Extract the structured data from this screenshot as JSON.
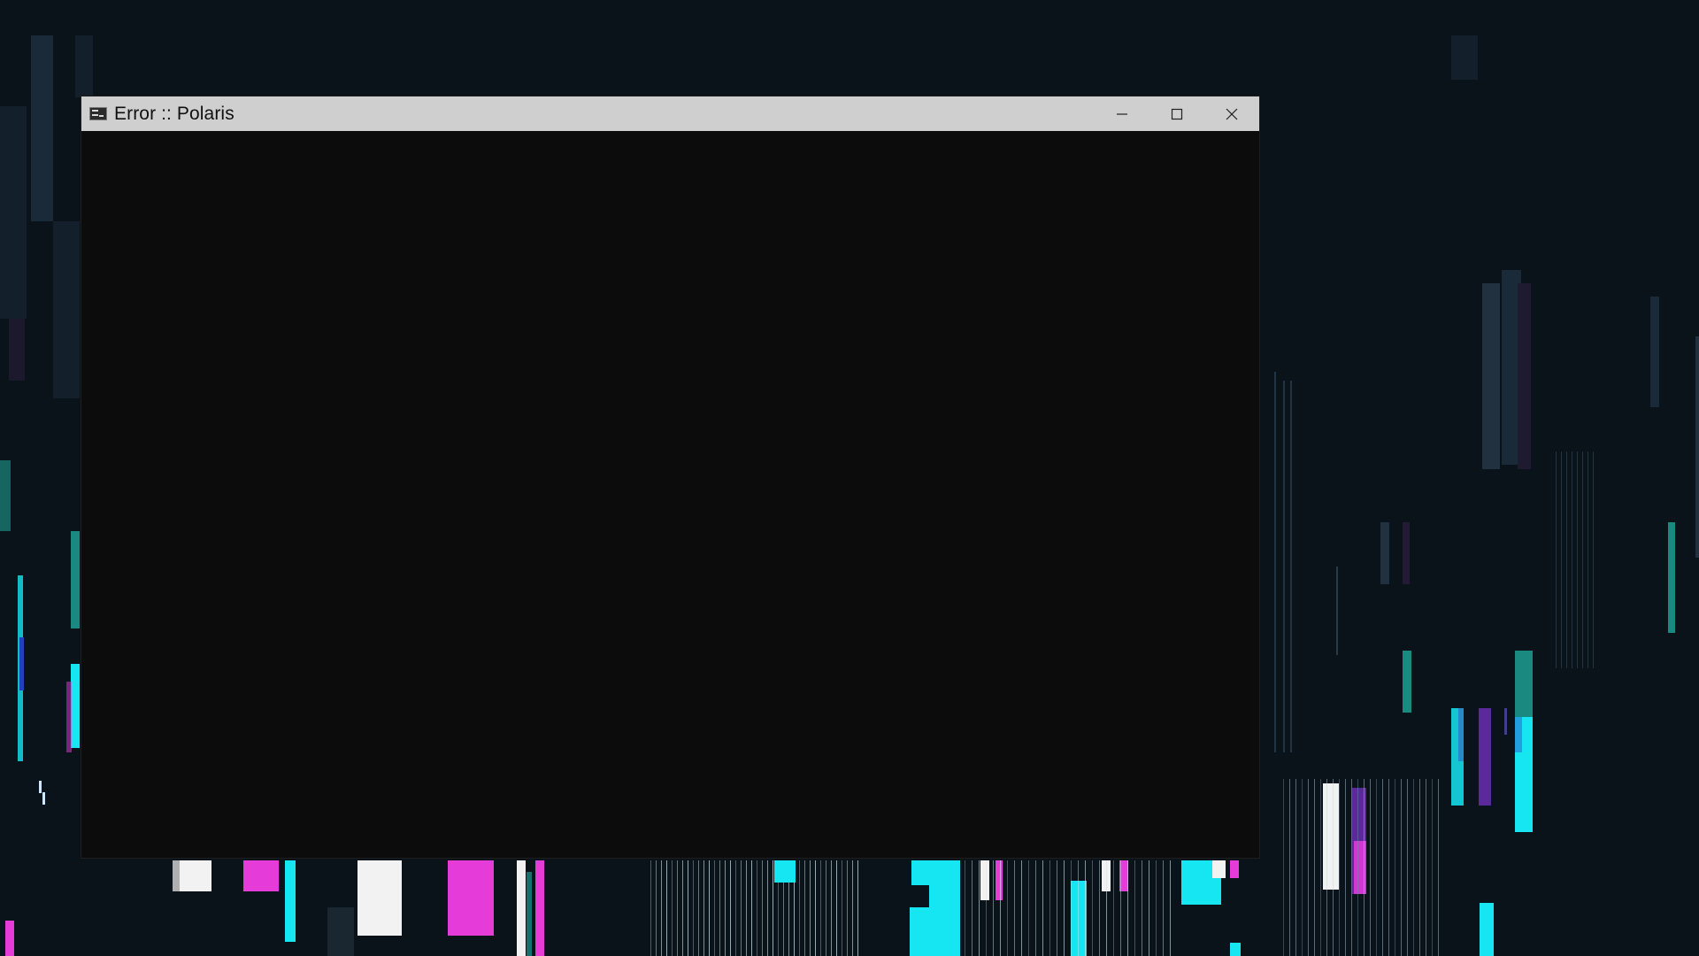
{
  "window": {
    "title": "Error :: Polaris",
    "icon": "console-icon",
    "controls": [
      "minimize-icon",
      "maximize-icon",
      "close-icon"
    ]
  },
  "colors": {
    "desktop_background": "#0a121a",
    "titlebar": "#cfcfcf",
    "console_background": "#0c0c0c",
    "glitch_cyan": "#16e6f2",
    "glitch_magenta": "#e53cd9",
    "glitch_white": "#f2f2f2",
    "glitch_teal": "#1a8a80",
    "glitch_purple": "#5a2a9a"
  }
}
